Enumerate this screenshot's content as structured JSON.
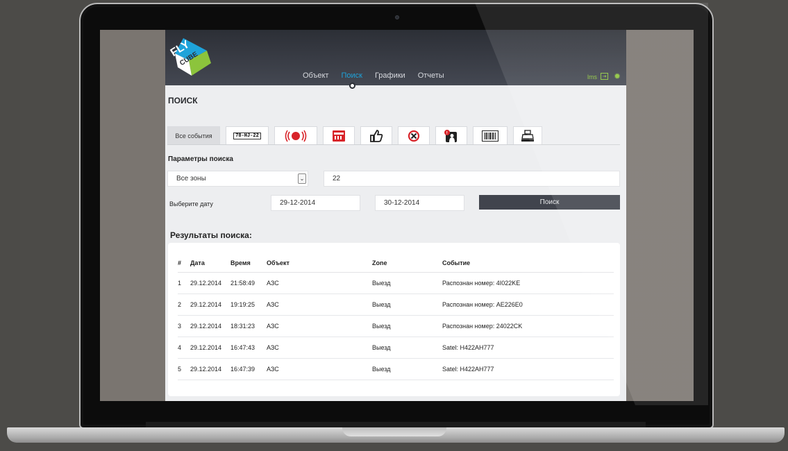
{
  "nav": {
    "items": [
      {
        "label": "Объект",
        "active": false
      },
      {
        "label": "Поиск",
        "active": true
      },
      {
        "label": "Графики",
        "active": false
      },
      {
        "label": "Отчеты",
        "active": false
      }
    ],
    "user": "lms"
  },
  "logo": {
    "line1": "FLY",
    "line2": "CUBE",
    "colors": [
      "#1ea3da",
      "#8cc43c"
    ]
  },
  "page_title": "ПОИСК",
  "tabs": {
    "first_label": "Все события",
    "plate_text": "78-HJ-22",
    "icons": [
      "alarm-icon",
      "terminal-icon",
      "thumb-icon",
      "forbidden-icon",
      "person-alert-icon",
      "barcode-icon",
      "cash-register-icon"
    ]
  },
  "search": {
    "section_label": "Параметры поиска",
    "zone_value": "Все зоны",
    "query_value": "22",
    "date_label": "Выберите дату",
    "date_from": "29-12-2014",
    "date_to": "30-12-2014",
    "button_label": "Поиск"
  },
  "results": {
    "title": "Результаты поиска:",
    "headers": [
      "#",
      "Дата",
      "Время",
      "Объект",
      "Zone",
      "Событие"
    ],
    "rows": [
      [
        "1",
        "29.12.2014",
        "21:58:49",
        "АЗС",
        "Выезд",
        "Распознан номер: 4I022KE"
      ],
      [
        "2",
        "29.12.2014",
        "19:19:25",
        "АЗС",
        "Выезд",
        "Распознан номер: AE226E0"
      ],
      [
        "3",
        "29.12.2014",
        "18:31:23",
        "АЗС",
        "Выезд",
        "Распознан номер: 24022CK"
      ],
      [
        "4",
        "29.12.2014",
        "16:47:43",
        "АЗС",
        "Выезд",
        "Satel: H422AH777"
      ],
      [
        "5",
        "29.12.2014",
        "16:47:39",
        "АЗС",
        "Выезд",
        "Satel: H422AH777"
      ]
    ]
  },
  "colors": {
    "accent": "#1ea3da",
    "green": "#8cc43c",
    "red": "#d8242a",
    "dark": "#41444d"
  }
}
